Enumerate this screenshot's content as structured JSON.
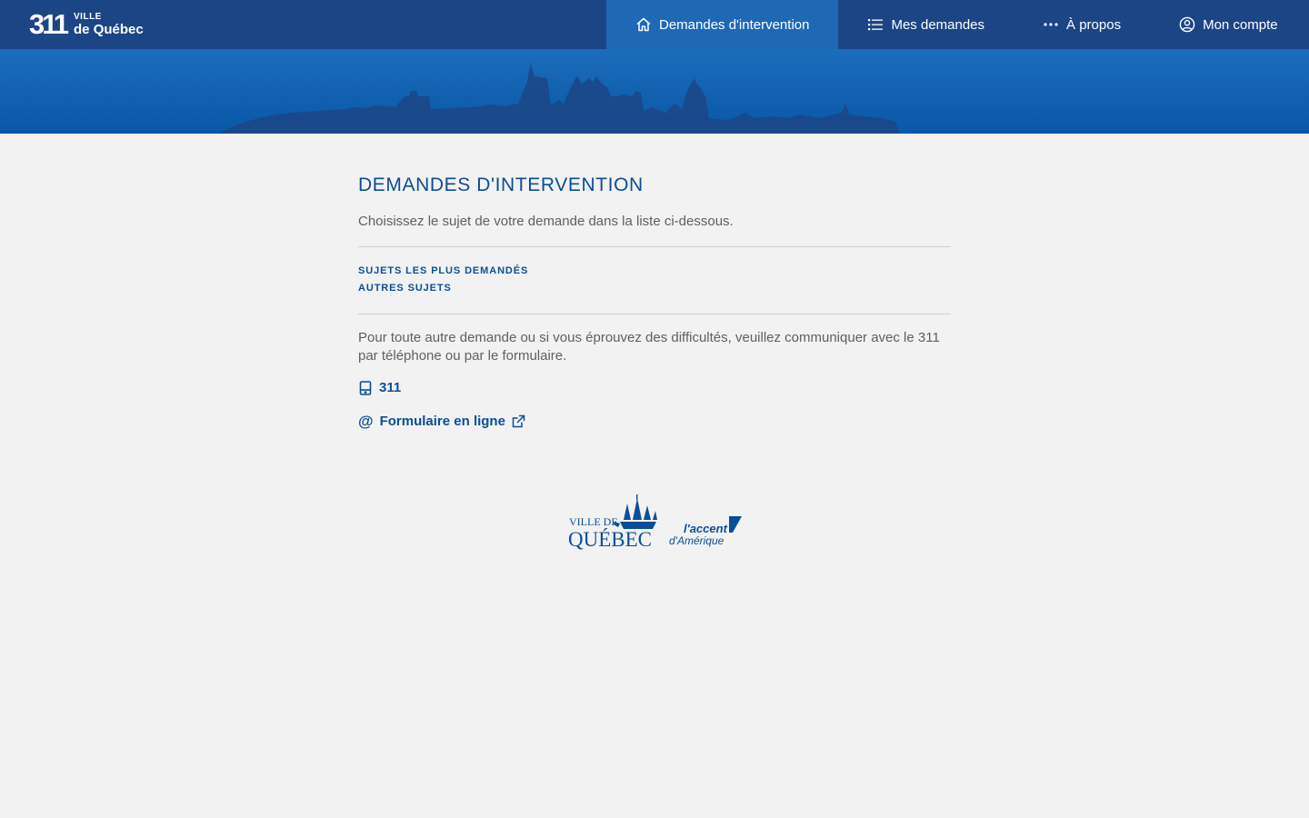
{
  "header": {
    "brand": {
      "number": "311",
      "line1": "VILLE",
      "line2": "de Québec"
    },
    "nav": [
      {
        "label": "Demandes d'intervention",
        "icon": "home-icon",
        "active": true
      },
      {
        "label": "Mes demandes",
        "icon": "list-icon",
        "active": false
      },
      {
        "label": "À propos",
        "icon": "more-dots-icon",
        "active": false
      },
      {
        "label": "Mon compte",
        "icon": "user-circle-icon",
        "active": false
      }
    ]
  },
  "main": {
    "title": "DEMANDES D'INTERVENTION",
    "intro": "Choisissez le sujet de votre demande dans la liste ci-dessous.",
    "topics": [
      {
        "label": "SUJETS LES PLUS DEMANDÉS"
      },
      {
        "label": "AUTRES SUJETS"
      }
    ],
    "help_text": "Pour toute autre demande ou si vous éprouvez des difficultés, veuillez communiquer avec le 311 par téléphone ou par le formulaire.",
    "phone": {
      "label": "311",
      "icon": "phone-icon"
    },
    "online_form": {
      "label": "Formulaire en ligne",
      "icon": "at-icon",
      "external_icon": "external-link-icon"
    }
  },
  "footer": {
    "logo_city_line1": "VILLE DE",
    "logo_city_line2": "QUÉBEC",
    "logo_slogan_line1": "l'accent",
    "logo_slogan_line2": "d'Amérique"
  },
  "colors": {
    "topbar": "#1c4586",
    "active_nav": "#1e68b6",
    "accent": "#0b4e97",
    "background": "#f2f2f2"
  }
}
